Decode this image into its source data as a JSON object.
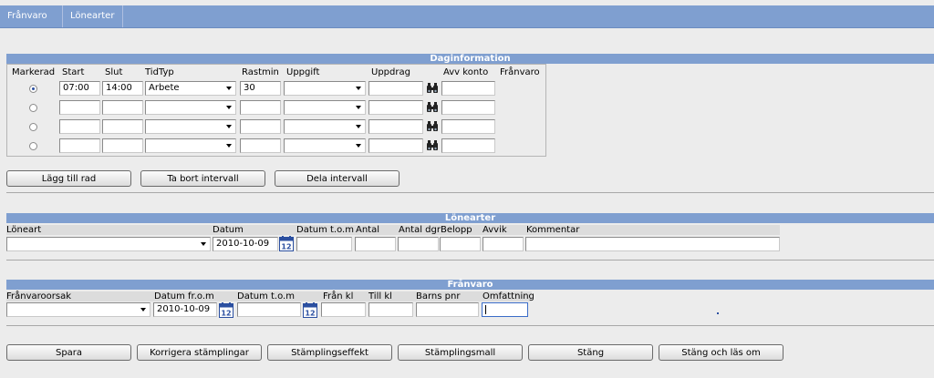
{
  "tabs": [
    {
      "label": "Frånvaro"
    },
    {
      "label": "Lönearter"
    }
  ],
  "daginfo": {
    "title": "Daginformation",
    "columns": {
      "markerad": "Markerad",
      "start": "Start",
      "slut": "Slut",
      "tidtyp": "TidTyp",
      "rastmin": "Rastmin",
      "uppgift": "Uppgift",
      "uppdrag": "Uppdrag",
      "avv_konto": "Avv konto",
      "franvaro": "Frånvaro"
    },
    "rows": [
      {
        "selected": true,
        "start": "07:00",
        "slut": "14:00",
        "tidtyp": "Arbete",
        "rastmin": "30",
        "uppgift": "",
        "uppdrag": "",
        "avv_konto": ""
      },
      {
        "selected": false,
        "start": "",
        "slut": "",
        "tidtyp": "",
        "rastmin": "",
        "uppgift": "",
        "uppdrag": "",
        "avv_konto": ""
      },
      {
        "selected": false,
        "start": "",
        "slut": "",
        "tidtyp": "",
        "rastmin": "",
        "uppgift": "",
        "uppdrag": "",
        "avv_konto": ""
      },
      {
        "selected": false,
        "start": "",
        "slut": "",
        "tidtyp": "",
        "rastmin": "",
        "uppgift": "",
        "uppdrag": "",
        "avv_konto": ""
      }
    ],
    "buttons": {
      "add_row": "Lägg till rad",
      "remove_interval": "Ta bort intervall",
      "split_interval": "Dela intervall"
    }
  },
  "lonearter": {
    "title": "Lönearter",
    "columns": {
      "loneart": "Löneart",
      "datum": "Datum",
      "datum_tom": "Datum t.o.m",
      "antal": "Antal",
      "antal_dgr": "Antal dgr",
      "belopp": "Belopp",
      "avvik": "Avvik",
      "kommentar": "Kommentar"
    },
    "values": {
      "loneart": "",
      "datum": "2010-10-09",
      "datum_tom": "",
      "antal": "",
      "antal_dgr": "",
      "belopp": "",
      "avvik": "",
      "kommentar": ""
    }
  },
  "franvaro": {
    "title": "Frånvaro",
    "columns": {
      "orsak": "Frånvaroorsak",
      "datum_from": "Datum fr.o.m",
      "datum_tom": "Datum t.o.m",
      "fran_kl": "Från kl",
      "till_kl": "Till kl",
      "barns_pnr": "Barns pnr",
      "omfattning": "Omfattning"
    },
    "values": {
      "orsak": "",
      "datum_from": "2010-10-09",
      "datum_tom": "",
      "fran_kl": "",
      "till_kl": "",
      "barns_pnr": "",
      "omfattning": ""
    }
  },
  "calendar_icon_text": "12",
  "footer_buttons": {
    "spara": "Spara",
    "korrigera": "Korrigera stämplingar",
    "effekt": "Stämplingseffekt",
    "mall": "Stämplingsmall",
    "stang": "Stäng",
    "stang_las_om": "Stäng och läs om"
  },
  "colors": {
    "header_bar": "#7f9fd0",
    "background": "#ececec"
  }
}
